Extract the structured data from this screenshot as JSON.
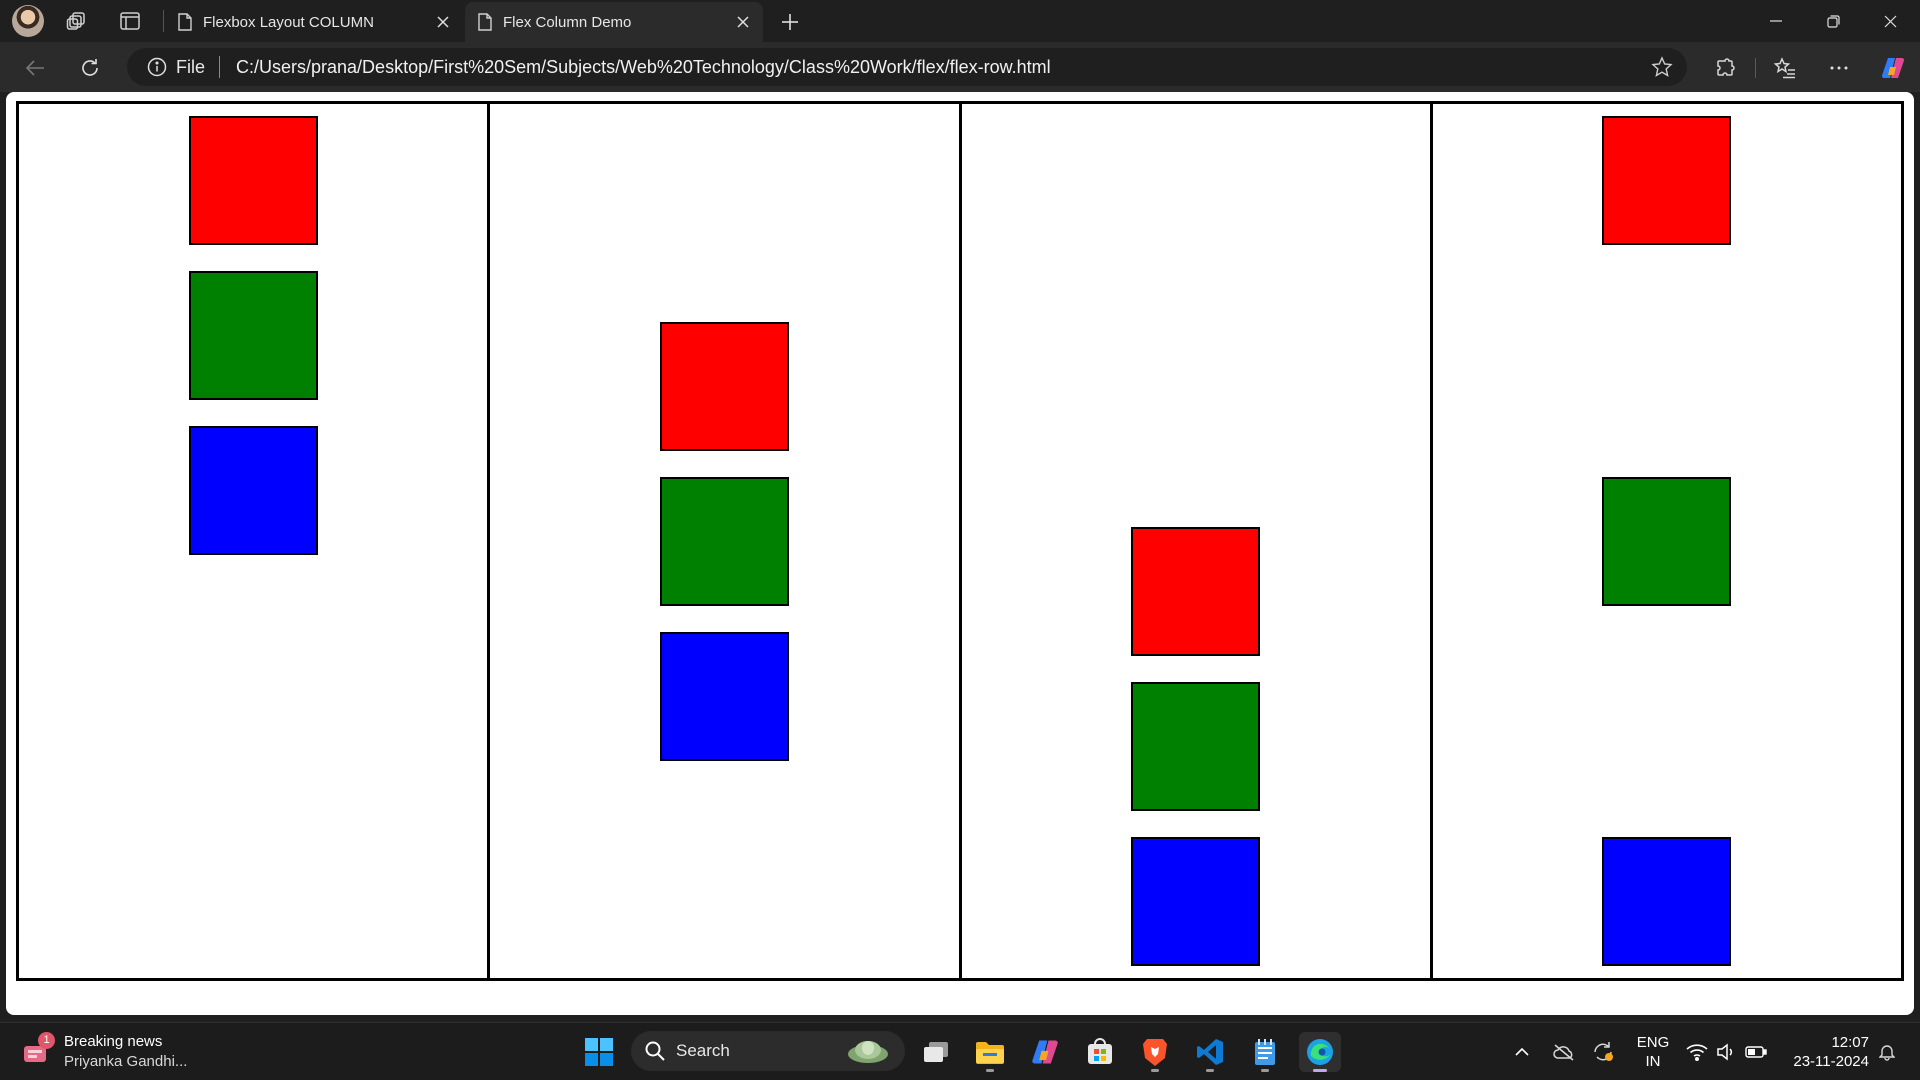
{
  "browser": {
    "tabs": [
      {
        "title": "Flexbox Layout COLUMN",
        "active": false
      },
      {
        "title": "Flex Column Demo",
        "active": true
      }
    ],
    "address": {
      "scheme_label": "File",
      "url": "C:/Users/prana/Desktop/First%20Sem/Subjects/Web%20Technology/Class%20Work/flex/flex-row.html"
    }
  },
  "page": {
    "columns": [
      {
        "justify": "flex-start",
        "boxes": [
          "#ff0000",
          "#008000",
          "#0000ff"
        ]
      },
      {
        "justify": "center",
        "boxes": [
          "#ff0000",
          "#008000",
          "#0000ff"
        ]
      },
      {
        "justify": "flex-end",
        "boxes": [
          "#ff0000",
          "#008000",
          "#0000ff"
        ]
      },
      {
        "justify": "space-between",
        "boxes": [
          "#ff0000",
          "#008000",
          "#0000ff"
        ]
      }
    ]
  },
  "taskbar": {
    "news": {
      "title": "Breaking news",
      "subtitle": "Priyanka Gandhi...",
      "badge": "1"
    },
    "search_label": "Search",
    "language": {
      "line1": "ENG",
      "line2": "IN"
    },
    "clock": {
      "time": "12:07",
      "date": "23-11-2024"
    }
  },
  "colors": {
    "chrome_bg": "#1f1f1f",
    "toolbar_bg": "#2b2b2b",
    "red": "#ff0000",
    "green": "#008000",
    "blue": "#0000ff"
  }
}
